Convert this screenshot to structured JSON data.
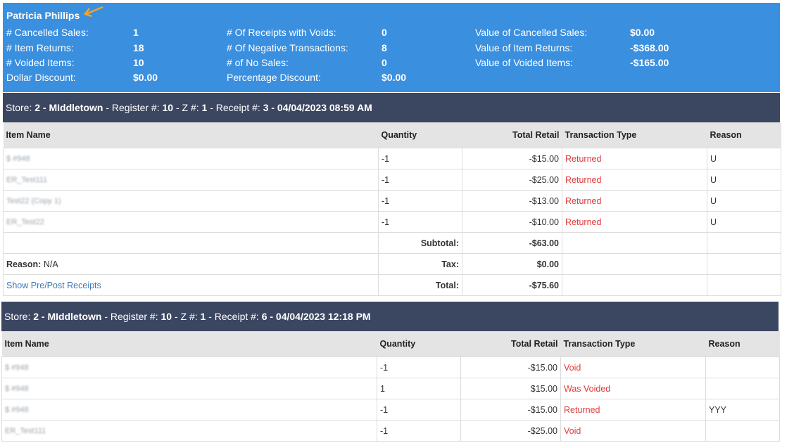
{
  "summary": {
    "employee_name": "Patricia Phillips",
    "stats": [
      {
        "label": "# Cancelled Sales:",
        "value": "1"
      },
      {
        "label": "# Item Returns:",
        "value": "18"
      },
      {
        "label": "# Voided Items:",
        "value": "10"
      },
      {
        "label": "Dollar Discount:",
        "value": "$0.00"
      },
      {
        "label": "# Of Receipts with Voids:",
        "value": "0"
      },
      {
        "label": "# Of Negative Transactions:",
        "value": "8"
      },
      {
        "label": "# of No Sales:",
        "value": "0"
      },
      {
        "label": "Percentage Discount:",
        "value": "$0.00"
      },
      {
        "label": "Value of Cancelled Sales:",
        "value": "$0.00"
      },
      {
        "label": "Value of Item Returns:",
        "value": "-$368.00"
      },
      {
        "label": "Value of Voided Items:",
        "value": "-$165.00"
      }
    ]
  },
  "columns": {
    "item_name": "Item Name",
    "quantity": "Quantity",
    "total_retail": "Total Retail",
    "transaction_type": "Transaction Type",
    "reason": "Reason"
  },
  "receipts": [
    {
      "header": {
        "store_label": "Store:",
        "store": "2 - MIddletown",
        "register_label": " - Register #:",
        "register": "10",
        "z_label": " - Z #:",
        "z": "1",
        "receipt_label": " - Receipt #:",
        "receipt": "3 - 04/04/2023 08:59 AM"
      },
      "rows": [
        {
          "item": "$ #948",
          "qty": "-1",
          "retail": "-$15.00",
          "type": "Returned",
          "reason": "U"
        },
        {
          "item": "ER_Test111",
          "qty": "-1",
          "retail": "-$25.00",
          "type": "Returned",
          "reason": "U"
        },
        {
          "item": "Test22 (Copy 1)",
          "qty": "-1",
          "retail": "-$13.00",
          "type": "Returned",
          "reason": "U"
        },
        {
          "item": "ER_Test22",
          "qty": "-1",
          "retail": "-$10.00",
          "type": "Returned",
          "reason": "U"
        }
      ],
      "subtotal_label": "Subtotal:",
      "subtotal": "-$63.00",
      "reason_label": "Reason:",
      "reason_value": "N/A",
      "tax_label": "Tax:",
      "tax": "$0.00",
      "show_link": "Show Pre/Post Receipts",
      "total_label": "Total:",
      "total": "-$75.60"
    },
    {
      "header": {
        "store_label": "Store:",
        "store": "2 - MIddletown",
        "register_label": " - Register #:",
        "register": "10",
        "z_label": " - Z #:",
        "z": "1",
        "receipt_label": " - Receipt #:",
        "receipt": "6 - 04/04/2023 12:18 PM"
      },
      "rows": [
        {
          "item": "$ #948",
          "qty": "-1",
          "retail": "-$15.00",
          "type": "Void",
          "reason": ""
        },
        {
          "item": "$ #948",
          "qty": "1",
          "retail": "$15.00",
          "type": "Was Voided",
          "reason": ""
        },
        {
          "item": "$ #948",
          "qty": "-1",
          "retail": "-$15.00",
          "type": "Returned",
          "reason": "YYY"
        },
        {
          "item": "ER_Test111",
          "qty": "-1",
          "retail": "-$25.00",
          "type": "Void",
          "reason": ""
        }
      ]
    }
  ]
}
